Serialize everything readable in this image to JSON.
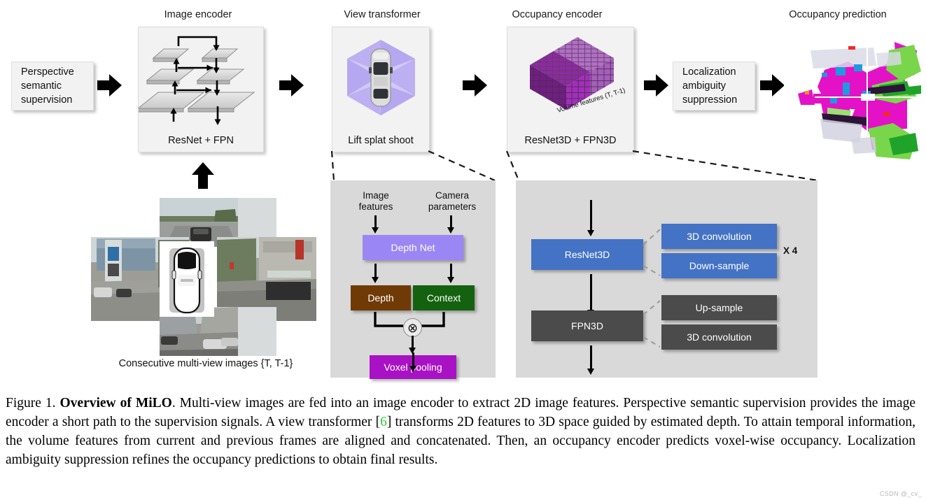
{
  "figure": {
    "sections": [
      {
        "id": "image-encoder",
        "title": "Image encoder",
        "panel_label": "ResNet + FPN"
      },
      {
        "id": "view-transformer",
        "title": "View transformer",
        "panel_label": "Lift splat shoot"
      },
      {
        "id": "occupancy-encoder",
        "title": "Occupancy encoder",
        "panel_label": "ResNet3D + FPN3D"
      },
      {
        "id": "occupancy-prediction",
        "title": "Occupancy prediction",
        "panel_label": ""
      }
    ],
    "input_box": "Perspective\nsemantic\nsupervision",
    "input_box_lines": [
      "Perspective",
      "semantic",
      "supervision"
    ],
    "post_box_lines": [
      "Localization",
      "ambiguity",
      "suppression"
    ],
    "multiview_caption": "Consecutive multi-view images {T, T-1}",
    "volume_label": "Volume features (T, T-1)"
  },
  "view_transformer_detail": {
    "inputs": [
      {
        "line1": "Image",
        "line2": "features"
      },
      {
        "line1": "Camera",
        "line2": "parameters"
      }
    ],
    "blocks": [
      {
        "label": "Depth Net",
        "color": "#9a87f5"
      },
      {
        "label": "Depth",
        "color": "#703a06"
      },
      {
        "label": "Context",
        "color": "#14620f"
      },
      {
        "label": "Voxel pooling",
        "color": "#a812c4"
      }
    ],
    "operator": "⊗"
  },
  "occupancy_encoder_detail": {
    "stages": [
      {
        "label": "ResNet3D",
        "color": "#4472c4",
        "subblocks": [
          "3D convolution",
          "Down-sample"
        ],
        "repeat": "X 4"
      },
      {
        "label": "FPN3D",
        "color": "#4b4b4b",
        "subblocks": [
          "Up-sample",
          "3D convolution"
        ],
        "repeat": ""
      }
    ]
  },
  "caption": {
    "prefix": "Figure 1. ",
    "bold_title": "Overview of MiLO",
    "body_1": ". Multi-view images are fed into an image encoder to extract 2D image features.  Perspective semantic supervision provides the image encoder a short path to the supervision signals.  A view transformer [",
    "citation": "6",
    "body_2": "] transforms 2D features to 3D space guided by estimated depth.  To attain temporal information, the volume features from current and previous frames are aligned and concatenated.  Then, an occupancy encoder predicts voxel-wise occupancy.  Localization ambiguity suppression refines the occupancy predictions to obtain final results."
  },
  "watermark": "CSDN @_cv_",
  "colors": {
    "panel_bg": "#f2f2f2",
    "detail_bg": "#d9d9d9",
    "blue": "#4472c4",
    "dark_gray": "#4b4b4b",
    "purple_light": "#9a87f5",
    "brown": "#703a06",
    "green": "#14620f",
    "magenta": "#a812c4",
    "citation_green": "#2ecc40"
  }
}
